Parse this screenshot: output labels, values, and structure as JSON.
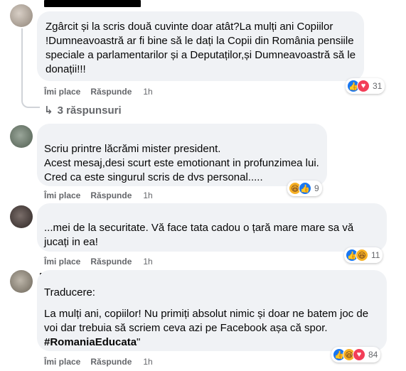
{
  "comments": [
    {
      "text": "Zgârcit și la scris două cuvinte doar atât?La mulți ani Copiilor !Dumneavoastră ar fi bine să le dați la Copii din România pensiile speciale a parlamentarilor și a Deputaților,și Dumneavoastră să le donații!!!",
      "like_label": "Îmi place",
      "reply_label": "Răspunde",
      "time": "1h",
      "reaction_count": "31"
    },
    {
      "text_lines": [
        "Scriu printre lăcrămi mister president.",
        "Acest mesaj,desi scurt este emotionant in profunzimea lui.",
        "Cred ca este singurul scris de dvs personal....."
      ],
      "like_label": "Îmi place",
      "reply_label": "Răspunde",
      "time": "1h",
      "reaction_count": "9"
    },
    {
      "text": "...mei de la securitate. Vă face tata cadou o țară mare mare sa vă jucați in ea!",
      "like_label": "Îmi place",
      "reply_label": "Răspunde",
      "time": "1h",
      "reaction_count": "11"
    },
    {
      "heading": "Traducere:",
      "text": "La mulți ani, copiilor! Nu primiți absolut nimic și doar ne batem joc de voi dar trebuia să scriem ceva azi pe Facebook așa că spor.",
      "hashtag": "#RomaniaEducata",
      "suffix": "\"",
      "like_label": "Îmi place",
      "reply_label": "Răspunde",
      "time": "1h",
      "reaction_count": "84"
    }
  ],
  "replies_link": "3 răspunsuri",
  "icons": {
    "like": "like-icon",
    "love": "love-icon",
    "haha": "haha-icon",
    "reply_arrow": "reply-arrow-icon"
  },
  "colors": {
    "like": "#1877f2",
    "love": "#f33e58",
    "haha": "#f7b125",
    "bubble": "#f0f2f5",
    "meta": "#65676b"
  }
}
